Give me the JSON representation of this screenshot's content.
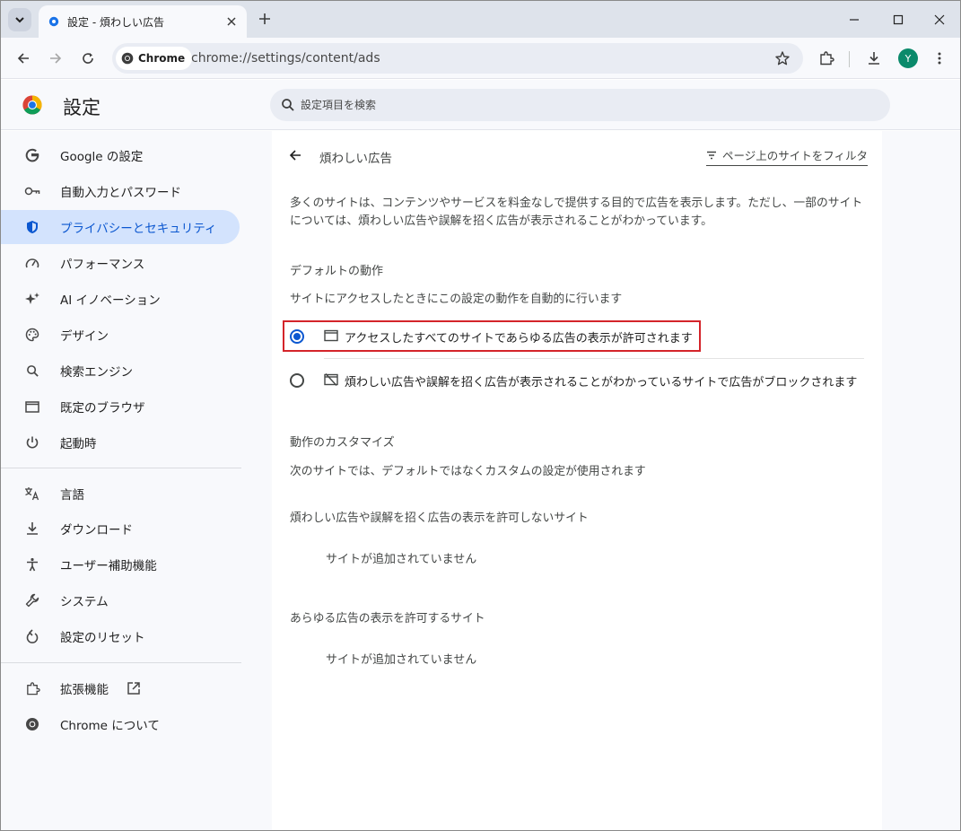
{
  "browser": {
    "tab_title": "設定 - 煩わしい広告",
    "chip_label": "Chrome",
    "url": "chrome://settings/content/ads",
    "avatar_letter": "Y"
  },
  "header": {
    "title": "設定",
    "search_placeholder": "設定項目を検索"
  },
  "sidebar": {
    "items": [
      {
        "label": "Google の設定",
        "icon": "google-g-icon"
      },
      {
        "label": "自動入力とパスワード",
        "icon": "key-icon"
      },
      {
        "label": "プライバシーとセキュリティ",
        "icon": "shield-icon",
        "active": true
      },
      {
        "label": "パフォーマンス",
        "icon": "speedometer-icon"
      },
      {
        "label": "AI イノベーション",
        "icon": "sparkle-icon"
      },
      {
        "label": "デザイン",
        "icon": "palette-icon"
      },
      {
        "label": "検索エンジン",
        "icon": "search-icon"
      },
      {
        "label": "既定のブラウザ",
        "icon": "browser-window-icon"
      },
      {
        "label": "起動時",
        "icon": "power-icon"
      },
      {
        "label": "言語",
        "icon": "translate-icon"
      },
      {
        "label": "ダウンロード",
        "icon": "download-icon"
      },
      {
        "label": "ユーザー補助機能",
        "icon": "accessibility-icon"
      },
      {
        "label": "システム",
        "icon": "wrench-icon"
      },
      {
        "label": "設定のリセット",
        "icon": "reset-icon"
      },
      {
        "label": "拡張機能",
        "icon": "puzzle-icon"
      },
      {
        "label": "Chrome について",
        "icon": "chrome-logo-icon"
      }
    ]
  },
  "page": {
    "title": "煩わしい広告",
    "filter_label": "ページ上のサイトをフィルタ",
    "description": "多くのサイトは、コンテンツやサービスを料金なしで提供する目的で広告を表示します。ただし、一部のサイトについては、煩わしい広告や誤解を招く広告が表示されることがわかっています。",
    "default_heading": "デフォルトの動作",
    "default_sub": "サイトにアクセスしたときにこの設定の動作を自動的に行います",
    "option_allow": "アクセスしたすべてのサイトであらゆる広告の表示が許可されます",
    "option_block": "煩わしい広告や誤解を招く広告が表示されることがわかっているサイトで広告がブロックされます",
    "selected_option": "allow",
    "custom_heading": "動作のカスタマイズ",
    "custom_sub": "次のサイトでは、デフォルトではなくカスタムの設定が使用されます",
    "block_list_heading": "煩わしい広告や誤解を招く広告の表示を許可しないサイト",
    "block_list_empty": "サイトが追加されていません",
    "allow_list_heading": "あらゆる広告の表示を許可するサイト",
    "allow_list_empty": "サイトが追加されていません"
  },
  "colors": {
    "accent": "#0b57d0",
    "active_nav_bg": "#d3e3fd",
    "highlight_box": "#d4242a"
  }
}
